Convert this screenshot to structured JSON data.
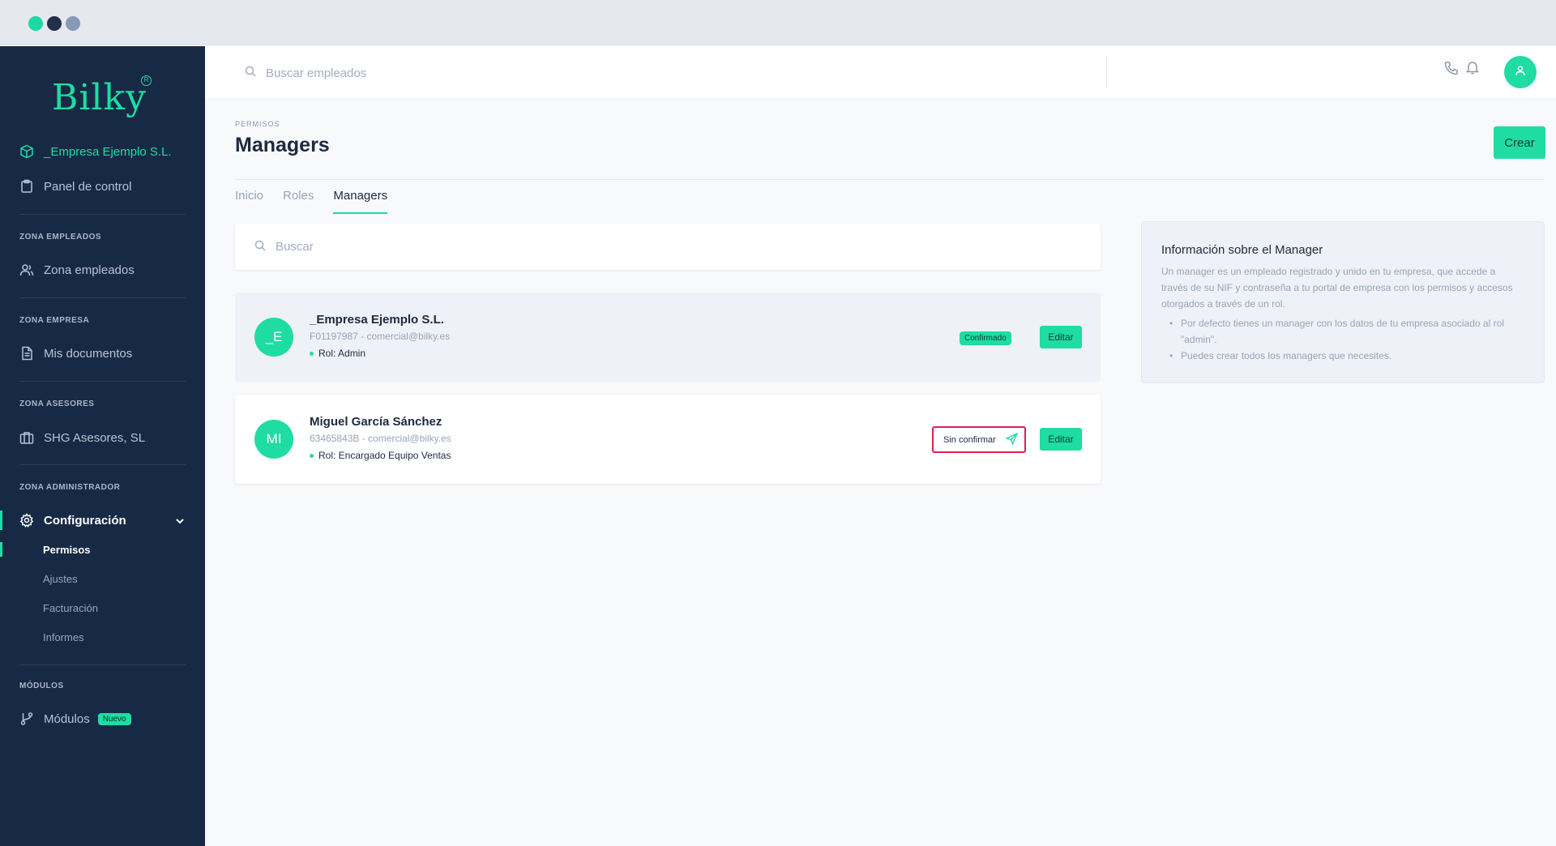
{
  "colors": {
    "accent": "#1fdca3",
    "sidebar_bg": "#172a45",
    "highlight_border": "#e0204f"
  },
  "sidebar": {
    "logo": "Bilky",
    "company": "_Empresa Ejemplo S.L.",
    "panel": "Panel de control",
    "sections": {
      "empleados": "ZONA EMPLEADOS",
      "empresa": "ZONA EMPRESA",
      "asesores": "ZONA ASESORES",
      "administrador": "ZONA ADMINISTRADOR",
      "modulos": "MÓDULOS"
    },
    "zona_empleados": "Zona empleados",
    "mis_documentos": "Mis documentos",
    "asesor": "SHG Asesores, SL",
    "configuracion": "Configuración",
    "sub": {
      "permisos": "Permisos",
      "ajustes": "Ajustes",
      "facturacion": "Facturación",
      "informes": "Informes"
    },
    "modulos": "Módulos",
    "nuevo_badge": "Nuevo"
  },
  "topbar": {
    "search_placeholder": "Buscar empleados"
  },
  "page": {
    "breadcrumb": "PERMISOS",
    "title": "Managers",
    "create_button": "Crear",
    "tabs": [
      "Inicio",
      "Roles",
      "Managers"
    ],
    "search_placeholder": "Buscar"
  },
  "managers": [
    {
      "initials": "_E",
      "name": "_Empresa Ejemplo S.L.",
      "id_email": "F01197987 - comercial@bilky.es",
      "role": "Rol: Admin",
      "status": "Confirmado",
      "edit": "Editar"
    },
    {
      "initials": "MI",
      "name": "Miguel García Sánchez",
      "id_email": "63465843B - comercial@bilky.es",
      "role": "Rol: Encargado Equipo Ventas",
      "status": "Sin confirmar",
      "edit": "Editar"
    }
  ],
  "info": {
    "title": "Información sobre el Manager",
    "text": "Un manager es un empleado registrado y unido en tu empresa, que accede a través de su NIF y contraseña a tu portal de empresa con los permisos y accesos otorgados a través de un rol.",
    "bullets": [
      "Por defecto tienes un manager con los datos de tu empresa asociado al rol \"admin\".",
      "Puedes crear todos los managers que necesites."
    ]
  }
}
